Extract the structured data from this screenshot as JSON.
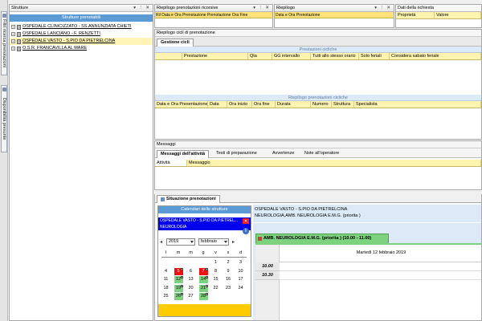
{
  "left_strip": {
    "tab1": "Filtri ricerca prenotazioni",
    "tab2": "Disponibilità presunte"
  },
  "strutture": {
    "title": "Strutture",
    "header": "Strutture prenotabili",
    "items": [
      {
        "label": "OSPEDALE CLINICIZZATO - SS.ANNUNZIATA CHIETI"
      },
      {
        "label": "OSPEDALE LANCIANO - F. RENZETTI"
      },
      {
        "label": "OSPEDALE VASTO - S.PIO DA PIETRELCINA"
      },
      {
        "label": "O.S.R. FRANCAVILLA AL MARE"
      }
    ]
  },
  "top_panels": {
    "ricorsive_title": "Riepilogo prenotazioni ricorsive",
    "ricorsive_strip": "Ril  Data e Ora Prenotazione  Prenotazione  Ora  Fine",
    "riepilogo_title": "Riepilogo",
    "riepilogo_strip": "Data e Ora Prenotazione",
    "dati_title": "Dati della richiesta",
    "dati_cols": [
      "Proprietà",
      "Valore"
    ]
  },
  "cicli": {
    "section": "Riepilogo cicli di prenotazione",
    "tab": "Gestione cicli",
    "band": "Prestazioni cicliche",
    "columns": [
      "Prestazione",
      "Qta",
      "GG intervallo",
      "Tutti allo stesso orario",
      "Solo feriali",
      "Considera sabato feriale"
    ],
    "band2": "Riepilogo prenotazioni cicliche",
    "columns2": [
      "Data e Ora Presentazione",
      "Data",
      "Ora inizio",
      "Ora fine",
      "Durata",
      "Numero",
      "Struttura",
      "Specialista"
    ]
  },
  "messaggi": {
    "section": "Messaggi",
    "tabs": [
      "Messaggi dell'attività",
      "Testi di preparazione",
      "Avvertenze",
      "Note all'operatore"
    ],
    "columns": [
      "Attività",
      "Messaggio"
    ]
  },
  "situazione": {
    "tab": "Situazione prenotazioni",
    "cal_header": "Calendari delle strutture",
    "struct_line": "OSPEDALE VASTO - S.PIO DA PIETREL...",
    "dept_line": "NEUROLOGIA",
    "year": "2019",
    "month": "febbraio",
    "weekdays": [
      "l",
      "m",
      "m",
      "g",
      "v",
      "s",
      "d"
    ],
    "weeks": [
      [
        "",
        "",
        "",
        "",
        "1",
        "2",
        "3"
      ],
      [
        "4",
        "5",
        "6",
        "7",
        "8",
        "9",
        "10"
      ],
      [
        "11",
        "12",
        "13",
        "14",
        "15",
        "16",
        "17"
      ],
      [
        "18",
        "19",
        "20",
        "21",
        "22",
        "23",
        "24"
      ],
      [
        "25",
        "26",
        "27",
        "28",
        "",
        "",
        ""
      ]
    ],
    "info_line1": "OSPEDALE VASTO - S.PIO DA PIETRELCINA",
    "info_line2": "NEUROLOGIA,AMB. NEUROLOGIA E.M.G. (priorita )",
    "agenda_tab": "AMB. NEUROLOGIA E.M.G. (priorita ) (10.00 - 11.00)",
    "agenda_date": "Martedì 12 febbraio 2019",
    "times": [
      "10.00",
      "10.30"
    ]
  },
  "colors": {
    "blue_header": "#5b9bd5",
    "calendar_blue": "#0000ee",
    "red_day": "#ee1111",
    "green_day": "#7ed17e",
    "yellow": "#ffcc00"
  }
}
